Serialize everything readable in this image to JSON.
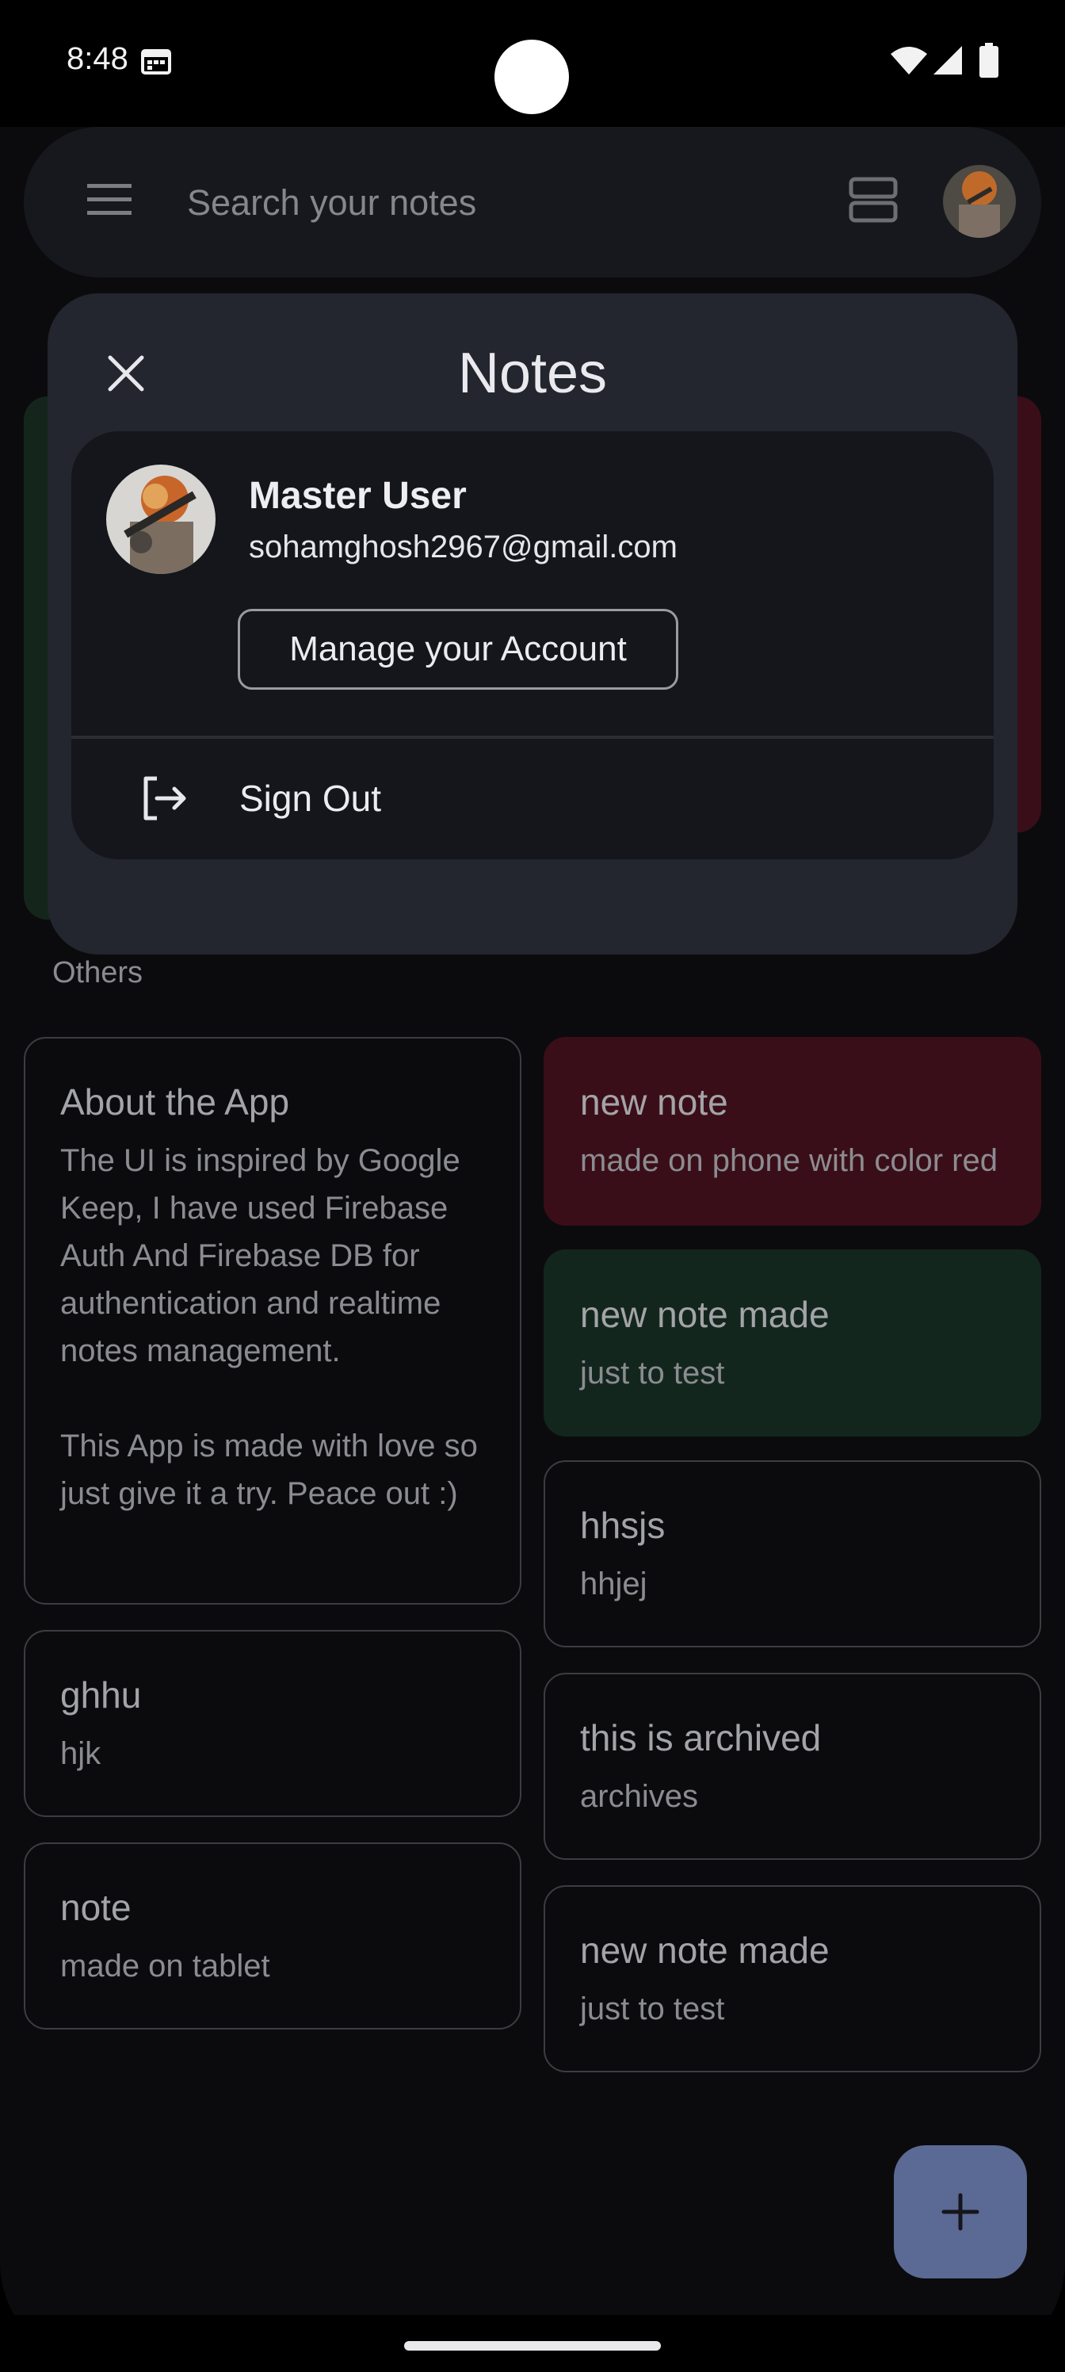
{
  "status_bar": {
    "time": "8:48"
  },
  "search": {
    "placeholder": "Search your notes"
  },
  "modal": {
    "title": "Notes",
    "account": {
      "name": "Master User",
      "email": "sohamghosh2967@gmail.com",
      "manage_label": "Manage your Account"
    },
    "sign_out_label": "Sign Out"
  },
  "section": {
    "others_label": "Others"
  },
  "notes": [
    {
      "title": "About the App",
      "body": "The UI is inspired by Google Keep, I have used Firebase Auth And Firebase DB for authentication and realtime notes management.\n\nThis App is made with love so just give it a try. Peace out :)",
      "color": "#0b0b0d"
    },
    {
      "title": "new note",
      "body": "made on phone with color red",
      "color": "#3a0e18"
    },
    {
      "title": "new note made",
      "body": "just to test",
      "color": "#13261d"
    },
    {
      "title": "hhsjs",
      "body": "hhjej",
      "color": "#0b0b0d"
    },
    {
      "title": "ghhu",
      "body": "hjk",
      "color": "#0b0b0d"
    },
    {
      "title": "this is archived",
      "body": "archives",
      "color": "#0b0b0d"
    },
    {
      "title": "note",
      "body": "made on tablet",
      "color": "#0b0b0d"
    },
    {
      "title": "new note made",
      "body": "just to test",
      "color": "#0b0b0d"
    }
  ],
  "colors": {
    "fab": "#5b6a94",
    "modal": "#23252f",
    "card": "#15161b"
  }
}
